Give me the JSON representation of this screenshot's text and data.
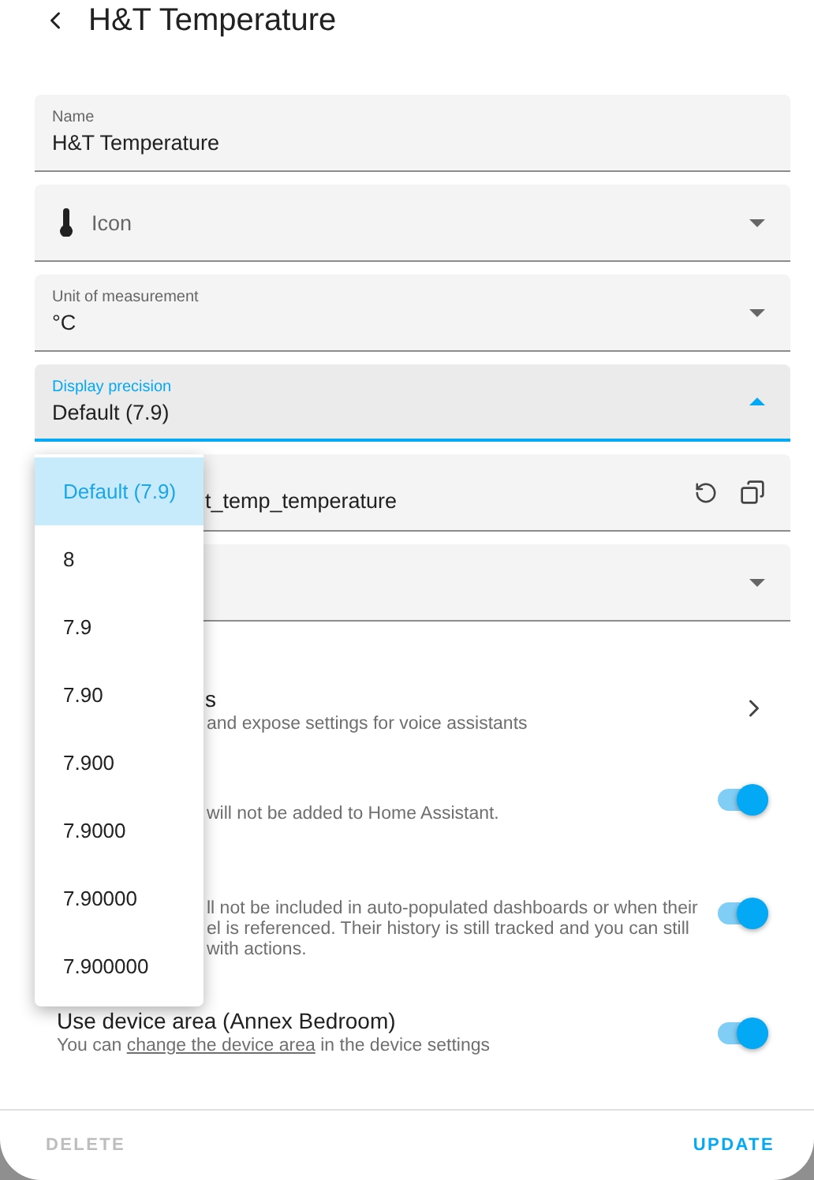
{
  "header": {
    "title": "H&T Temperature"
  },
  "fields": [
    {
      "kind": "text",
      "label": "Name",
      "value": "H&T Temperature"
    },
    {
      "kind": "icon_select",
      "placeholder": "Icon"
    },
    {
      "kind": "select",
      "label": "Unit of measurement",
      "value": "°C",
      "expanded": false
    },
    {
      "kind": "select",
      "label": "Display precision",
      "value": "Default (7.9)",
      "expanded": true
    },
    {
      "kind": "entity_id",
      "value": "t_temp_temperature"
    },
    {
      "kind": "select",
      "expanded": false
    }
  ],
  "menu": {
    "options": [
      {
        "label": "Default (7.9)",
        "selected": true
      },
      {
        "label": "8",
        "selected": false
      },
      {
        "label": "7.9",
        "selected": false
      },
      {
        "label": "7.90",
        "selected": false
      },
      {
        "label": "7.900",
        "selected": false
      },
      {
        "label": "7.9000",
        "selected": false
      },
      {
        "label": "7.90000",
        "selected": false
      },
      {
        "label": "7.900000",
        "selected": false
      }
    ]
  },
  "settings": [
    {
      "kind": "link",
      "title": "s",
      "lines": [
        "and expose settings for voice assistants"
      ]
    },
    {
      "kind": "toggle",
      "on": true,
      "lines": [
        "will not be added to Home Assistant."
      ]
    },
    {
      "kind": "toggle",
      "on": true,
      "lines": [
        "ll not be included in auto-populated dashboards or when their",
        "el is referenced. Their history is still tracked and you can still",
        "with actions."
      ]
    },
    {
      "kind": "toggle",
      "on": true,
      "title": "Use device area (Annex Bedroom)",
      "description_before": "You can ",
      "description_link": "change the device area",
      "description_after": " in the device settings"
    }
  ],
  "buttons": [
    {
      "label": "DELETE",
      "disabled": true
    },
    {
      "label": "UPDATE",
      "disabled": false
    }
  ]
}
